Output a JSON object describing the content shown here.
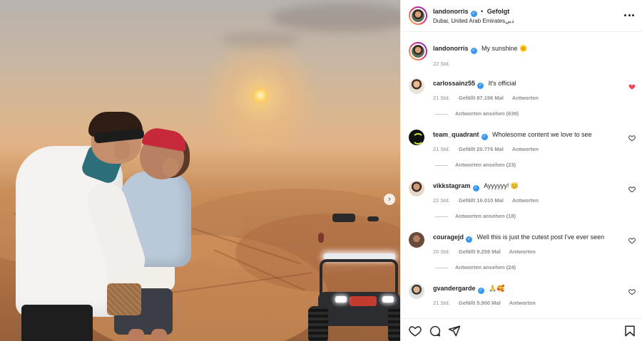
{
  "post": {
    "author": "landonorris",
    "follow_status": "Gefolgt",
    "location": "Dubai, United Arab Emiratesدبي",
    "caption_text": "My sunshine 🌞",
    "caption_time": "22 Std."
  },
  "comments": [
    {
      "user": "carlossainz55",
      "text": "It's official",
      "time": "21 Std.",
      "likes": "Gefällt 87.196 Mal",
      "reply_label": "Antworten",
      "view_replies": "Antworten ansehen (639)",
      "liked": true
    },
    {
      "user": "team_quadrant",
      "text": "Wholesome content we love to see",
      "time": "21 Std.",
      "likes": "Gefällt 20.776 Mal",
      "reply_label": "Antworten",
      "view_replies": "Antworten ansehen (23)",
      "liked": false
    },
    {
      "user": "vikkstagram",
      "text": "Ayyyyyy! 😊",
      "time": "22 Std.",
      "likes": "Gefällt 16.010 Mal",
      "reply_label": "Antworten",
      "view_replies": "Antworten ansehen (18)",
      "liked": false
    },
    {
      "user": "couragejd",
      "text": "Well this is just the cutest post I've ever seen",
      "time": "20 Std.",
      "likes": "Gefällt 9.259 Mal",
      "reply_label": "Antworten",
      "view_replies": "Antworten ansehen (24)",
      "liked": false
    },
    {
      "user": "gvandergarde",
      "text": "🙏🥰",
      "time": "21 Std.",
      "likes": "Gefällt 5.900 Mal",
      "reply_label": "Antworten",
      "liked": false
    }
  ],
  "icons": {
    "verified": "verified-badge-icon",
    "more": "more-options-icon",
    "like": "heart-icon",
    "comment": "comment-icon",
    "share": "share-icon",
    "save": "bookmark-icon",
    "next": "chevron-right-icon"
  },
  "colors": {
    "verified_blue": "#3897f0",
    "liked_red": "#ed4956",
    "muted_text": "#8e8e8e"
  }
}
